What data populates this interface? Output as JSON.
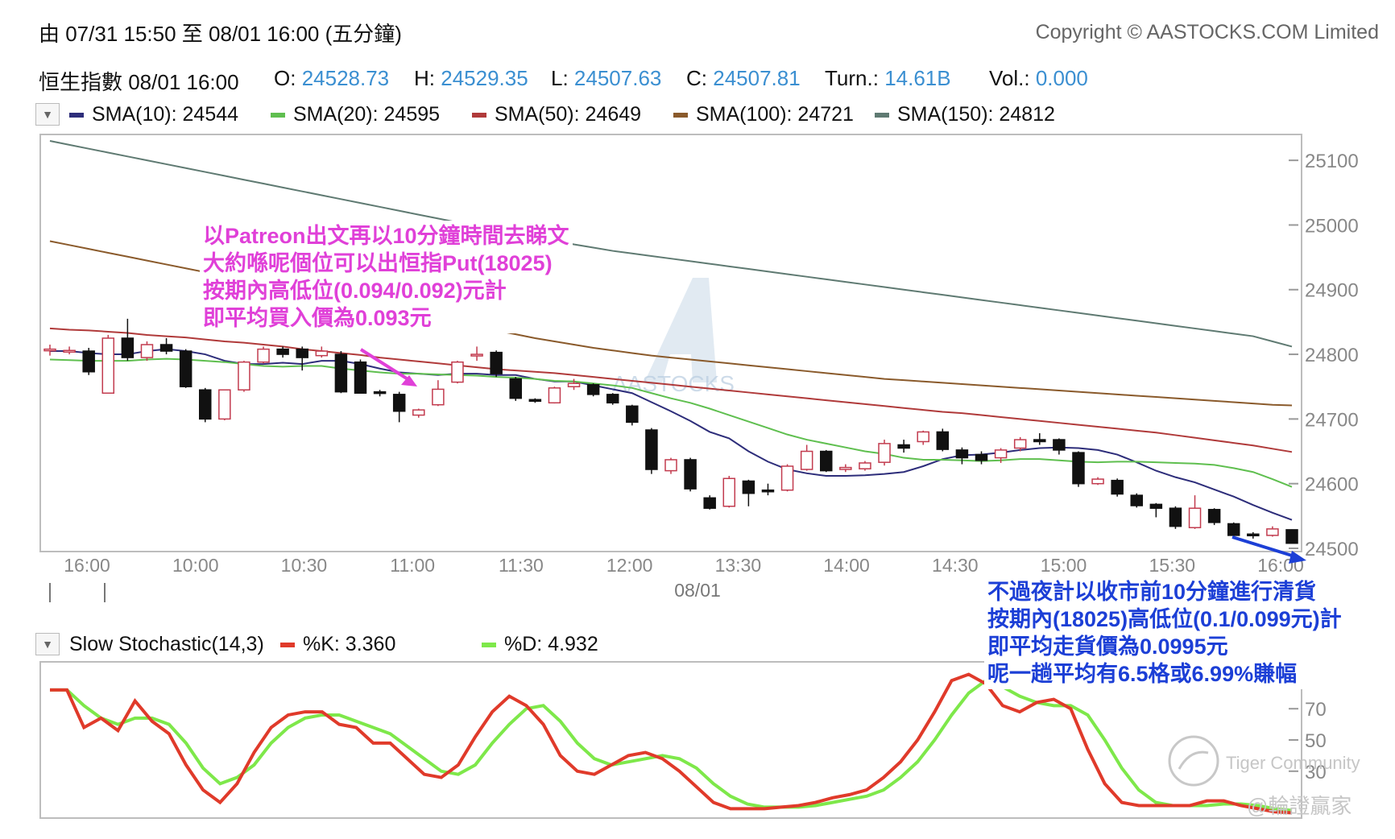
{
  "header": {
    "range": "由  07/31 15:50 至  08/01 16:00 (五分鐘)",
    "copyright": "Copyright © AASTOCKS.COM Limited"
  },
  "quote": {
    "name_time": "恒生指數 08/01 16:00",
    "o_label": "O:",
    "o_value": "24528.73",
    "h_label": "H:",
    "h_value": "24529.35",
    "l_label": "L:",
    "l_value": "24507.63",
    "c_label": "C:",
    "c_value": "24507.81",
    "turn_label": "Turn.:",
    "turn_value": "14.61B",
    "vol_label": "Vol.:",
    "vol_value": "0.000"
  },
  "legend": [
    {
      "label": "SMA(10): 24544",
      "color": "#2d2d7a"
    },
    {
      "label": "SMA(20): 24595",
      "color": "#5fbf4f"
    },
    {
      "label": "SMA(50): 24649",
      "color": "#b03a3a"
    },
    {
      "label": "SMA(100): 24721",
      "color": "#8a5a2b"
    },
    {
      "label": "SMA(150): 24812",
      "color": "#5f7a72"
    }
  ],
  "stoch_legend": {
    "title": "Slow Stochastic(14,3)",
    "k_label": "%K: 3.360",
    "k_color": "#e03a2a",
    "d_label": "%D: 4.932",
    "d_color": "#7ee84a"
  },
  "annotations": {
    "top_left": [
      "以Patreon出文再以10分鐘時間去睇文",
      "大約喺呢個位可以出恒指Put(18025)",
      "按期內高低位(0.094/0.092)元計",
      "即平均買入價為0.093元"
    ],
    "bottom_right": [
      "不過夜計以收市前10分鐘進行清貨",
      "按期內(18025)高低位(0.1/0.099元)計",
      "即平均走貨價為0.0995元",
      "呢一趟平均有6.5格或6.99%賺幅"
    ],
    "watermark": "AASTOCKS",
    "tiger": "Tiger Community",
    "author": "@輪證贏家"
  },
  "chart_data": [
    {
      "type": "candlestick",
      "title": "",
      "x_tick_labels": [
        "16:00",
        "10:00",
        "10:30",
        "11:00",
        "11:30",
        "12:00",
        "13:30",
        "14:00",
        "14:30",
        "15:00",
        "15:30",
        "16:00"
      ],
      "date_label": "08/01",
      "y_ticks": [
        25100,
        25000,
        24900,
        24800,
        24700,
        24600,
        24500
      ],
      "ylim": [
        24495,
        25140
      ],
      "candles": [
        {
          "o": 24808,
          "h": 24815,
          "l": 24798,
          "c": 24808
        },
        {
          "o": 24806,
          "h": 24812,
          "l": 24800,
          "c": 24806
        },
        {
          "o": 24805,
          "h": 24810,
          "l": 24768,
          "c": 24773
        },
        {
          "o": 24740,
          "h": 24830,
          "l": 24740,
          "c": 24825
        },
        {
          "o": 24825,
          "h": 24855,
          "l": 24790,
          "c": 24795
        },
        {
          "o": 24795,
          "h": 24820,
          "l": 24790,
          "c": 24815
        },
        {
          "o": 24815,
          "h": 24825,
          "l": 24800,
          "c": 24805
        },
        {
          "o": 24805,
          "h": 24808,
          "l": 24748,
          "c": 24750
        },
        {
          "o": 24745,
          "h": 24748,
          "l": 24695,
          "c": 24700
        },
        {
          "o": 24700,
          "h": 24745,
          "l": 24698,
          "c": 24745
        },
        {
          "o": 24745,
          "h": 24790,
          "l": 24742,
          "c": 24788
        },
        {
          "o": 24788,
          "h": 24812,
          "l": 24786,
          "c": 24808
        },
        {
          "o": 24808,
          "h": 24812,
          "l": 24795,
          "c": 24800
        },
        {
          "o": 24808,
          "h": 24812,
          "l": 24775,
          "c": 24795
        },
        {
          "o": 24798,
          "h": 24812,
          "l": 24795,
          "c": 24805
        },
        {
          "o": 24800,
          "h": 24805,
          "l": 24740,
          "c": 24742
        },
        {
          "o": 24788,
          "h": 24792,
          "l": 24740,
          "c": 24740
        },
        {
          "o": 24742,
          "h": 24745,
          "l": 24735,
          "c": 24740
        },
        {
          "o": 24738,
          "h": 24742,
          "l": 24695,
          "c": 24712
        },
        {
          "o": 24706,
          "h": 24716,
          "l": 24702,
          "c": 24714
        },
        {
          "o": 24722,
          "h": 24760,
          "l": 24720,
          "c": 24746
        },
        {
          "o": 24757,
          "h": 24790,
          "l": 24755,
          "c": 24788
        },
        {
          "o": 24798,
          "h": 24812,
          "l": 24790,
          "c": 24800
        },
        {
          "o": 24803,
          "h": 24806,
          "l": 24765,
          "c": 24770
        },
        {
          "o": 24762,
          "h": 24765,
          "l": 24728,
          "c": 24732
        },
        {
          "o": 24730,
          "h": 24732,
          "l": 24725,
          "c": 24729
        },
        {
          "o": 24725,
          "h": 24750,
          "l": 24724,
          "c": 24748
        },
        {
          "o": 24750,
          "h": 24762,
          "l": 24745,
          "c": 24755
        },
        {
          "o": 24753,
          "h": 24755,
          "l": 24735,
          "c": 24738
        },
        {
          "o": 24738,
          "h": 24740,
          "l": 24722,
          "c": 24725
        },
        {
          "o": 24720,
          "h": 24722,
          "l": 24690,
          "c": 24695
        },
        {
          "o": 24683,
          "h": 24686,
          "l": 24615,
          "c": 24622
        },
        {
          "o": 24620,
          "h": 24640,
          "l": 24615,
          "c": 24637
        },
        {
          "o": 24637,
          "h": 24640,
          "l": 24588,
          "c": 24592
        },
        {
          "o": 24578,
          "h": 24582,
          "l": 24560,
          "c": 24562
        },
        {
          "o": 24565,
          "h": 24612,
          "l": 24563,
          "c": 24608
        },
        {
          "o": 24604,
          "h": 24606,
          "l": 24565,
          "c": 24585
        },
        {
          "o": 24590,
          "h": 24600,
          "l": 24582,
          "c": 24588
        },
        {
          "o": 24590,
          "h": 24630,
          "l": 24588,
          "c": 24627
        },
        {
          "o": 24622,
          "h": 24660,
          "l": 24620,
          "c": 24650
        },
        {
          "o": 24650,
          "h": 24652,
          "l": 24618,
          "c": 24620
        },
        {
          "o": 24622,
          "h": 24630,
          "l": 24618,
          "c": 24625
        },
        {
          "o": 24623,
          "h": 24635,
          "l": 24620,
          "c": 24632
        },
        {
          "o": 24633,
          "h": 24668,
          "l": 24628,
          "c": 24662
        },
        {
          "o": 24660,
          "h": 24668,
          "l": 24648,
          "c": 24655
        },
        {
          "o": 24665,
          "h": 24682,
          "l": 24660,
          "c": 24680
        },
        {
          "o": 24680,
          "h": 24685,
          "l": 24650,
          "c": 24653
        },
        {
          "o": 24652,
          "h": 24656,
          "l": 24630,
          "c": 24640
        },
        {
          "o": 24645,
          "h": 24650,
          "l": 24630,
          "c": 24636
        },
        {
          "o": 24640,
          "h": 24655,
          "l": 24632,
          "c": 24652
        },
        {
          "o": 24655,
          "h": 24672,
          "l": 24650,
          "c": 24668
        },
        {
          "o": 24668,
          "h": 24678,
          "l": 24660,
          "c": 24665
        },
        {
          "o": 24668,
          "h": 24670,
          "l": 24645,
          "c": 24652
        },
        {
          "o": 24648,
          "h": 24650,
          "l": 24595,
          "c": 24600
        },
        {
          "o": 24600,
          "h": 24610,
          "l": 24598,
          "c": 24607
        },
        {
          "o": 24605,
          "h": 24608,
          "l": 24580,
          "c": 24584
        },
        {
          "o": 24582,
          "h": 24585,
          "l": 24563,
          "c": 24566
        },
        {
          "o": 24568,
          "h": 24570,
          "l": 24548,
          "c": 24562
        },
        {
          "o": 24562,
          "h": 24565,
          "l": 24530,
          "c": 24534
        },
        {
          "o": 24532,
          "h": 24582,
          "l": 24530,
          "c": 24562
        },
        {
          "o": 24560,
          "h": 24562,
          "l": 24536,
          "c": 24540
        },
        {
          "o": 24538,
          "h": 24540,
          "l": 24515,
          "c": 24520
        },
        {
          "o": 24522,
          "h": 24525,
          "l": 24515,
          "c": 24520
        },
        {
          "o": 24520,
          "h": 24534,
          "l": 24518,
          "c": 24530
        },
        {
          "o": 24528.73,
          "h": 24529.35,
          "l": 24507.63,
          "c": 24507.81
        }
      ],
      "sma": [
        {
          "name": "SMA(10)",
          "color": "#2d2d7a",
          "values": [
            24805,
            24805,
            24802,
            24800,
            24800,
            24805,
            24808,
            24805,
            24800,
            24790,
            24785,
            24785,
            24787,
            24785,
            24790,
            24790,
            24785,
            24778,
            24772,
            24770,
            24768,
            24770,
            24770,
            24768,
            24768,
            24762,
            24758,
            24758,
            24752,
            24746,
            24740,
            24726,
            24712,
            24697,
            24680,
            24670,
            24650,
            24634,
            24622,
            24616,
            24612,
            24612,
            24613,
            24615,
            24618,
            24627,
            24638,
            24644,
            24645,
            24648,
            24652,
            24655,
            24656,
            24655,
            24652,
            24645,
            24633,
            24620,
            24610,
            24602,
            24591,
            24580,
            24567,
            24555,
            24544
          ]
        },
        {
          "name": "SMA(20)",
          "color": "#5fbf4f",
          "values": [
            24792,
            24791,
            24790,
            24790,
            24790,
            24792,
            24793,
            24792,
            24790,
            24788,
            24785,
            24782,
            24781,
            24782,
            24782,
            24778,
            24775,
            24772,
            24770,
            24770,
            24769,
            24768,
            24767,
            24765,
            24764,
            24762,
            24759,
            24758,
            24755,
            24752,
            24748,
            24740,
            24732,
            24725,
            24716,
            24706,
            24696,
            24686,
            24676,
            24668,
            24662,
            24656,
            24650,
            24646,
            24640,
            24637,
            24637,
            24636,
            24635,
            24636,
            24638,
            24638,
            24636,
            24634,
            24633,
            24634,
            24634,
            24633,
            24632,
            24631,
            24629,
            24624,
            24618,
            24607,
            24595
          ]
        },
        {
          "name": "SMA(50)",
          "color": "#b03a3a",
          "values": [
            24840,
            24838,
            24837,
            24835,
            24833,
            24830,
            24828,
            24826,
            24823,
            24820,
            24818,
            24815,
            24812,
            24808,
            24805,
            24802,
            24799,
            24795,
            24792,
            24789,
            24786,
            24783,
            24780,
            24777,
            24775,
            24773,
            24771,
            24768,
            24765,
            24762,
            24759,
            24756,
            24753,
            24750,
            24747,
            24744,
            24741,
            24738,
            24735,
            24732,
            24729,
            24726,
            24723,
            24720,
            24717,
            24714,
            24711,
            24709,
            24706,
            24703,
            24700,
            24697,
            24694,
            24691,
            24688,
            24685,
            24682,
            24679,
            24675,
            24671,
            24667,
            24663,
            24659,
            24654,
            24649
          ]
        },
        {
          "name": "SMA(100)",
          "color": "#8a5a2b",
          "values": [
            24975,
            24969,
            24963,
            24957,
            24951,
            24945,
            24939,
            24933,
            24927,
            24921,
            24915,
            24909,
            24903,
            24897,
            24891,
            24885,
            24879,
            24873,
            24867,
            24861,
            24855,
            24849,
            24843,
            24837,
            24831,
            24825,
            24820,
            24815,
            24810,
            24806,
            24802,
            24798,
            24795,
            24792,
            24789,
            24786,
            24783,
            24780,
            24777,
            24774,
            24771,
            24768,
            24765,
            24762,
            24760,
            24758,
            24756,
            24754,
            24752,
            24750,
            24748,
            24746,
            24744,
            24742,
            24740,
            24738,
            24736,
            24734,
            24732,
            24730,
            24728,
            24726,
            24724,
            24722,
            24721
          ]
        },
        {
          "name": "SMA(150)",
          "color": "#5f7a72",
          "values": [
            25130,
            25124,
            25118,
            25112,
            25106,
            25100,
            25094,
            25088,
            25082,
            25076,
            25070,
            25064,
            25058,
            25052,
            25046,
            25040,
            25034,
            25028,
            25022,
            25016,
            25010,
            25004,
            24998,
            24992,
            24986,
            24980,
            24975,
            24970,
            24965,
            24960,
            24956,
            24952,
            24948,
            24944,
            24940,
            24936,
            24932,
            24928,
            24924,
            24920,
            24916,
            24912,
            24908,
            24904,
            24900,
            24896,
            24892,
            24888,
            24884,
            24880,
            24876,
            24872,
            24868,
            24864,
            24860,
            24856,
            24852,
            24848,
            24844,
            24840,
            24836,
            24832,
            24828,
            24820,
            24812
          ]
        }
      ]
    },
    {
      "type": "line",
      "title": "Slow Stochastic(14,3)",
      "y_ticks": [
        70,
        50,
        30
      ],
      "ylim": [
        0,
        100
      ],
      "series": [
        {
          "name": "%K",
          "color": "#e03a2a",
          "values": [
            82,
            82,
            58,
            64,
            56,
            75,
            62,
            54,
            34,
            18,
            10,
            22,
            42,
            58,
            66,
            68,
            68,
            60,
            58,
            48,
            48,
            38,
            28,
            26,
            34,
            52,
            68,
            78,
            72,
            60,
            40,
            30,
            28,
            34,
            40,
            42,
            38,
            30,
            20,
            10,
            6,
            6,
            6,
            7,
            8,
            10,
            13,
            15,
            18,
            26,
            36,
            50,
            68,
            88,
            92,
            86,
            72,
            68,
            74,
            76,
            70,
            44,
            22,
            10,
            8,
            8,
            8,
            8,
            11,
            11,
            8,
            6,
            4,
            3.36
          ]
        },
        {
          "name": "%D",
          "color": "#7ee84a",
          "values": [
            82,
            82,
            72,
            64,
            60,
            64,
            64,
            60,
            48,
            32,
            22,
            26,
            34,
            48,
            58,
            64,
            66,
            66,
            62,
            58,
            54,
            46,
            38,
            30,
            28,
            34,
            48,
            60,
            70,
            72,
            62,
            48,
            38,
            34,
            36,
            38,
            40,
            38,
            32,
            22,
            14,
            9,
            7,
            7,
            7,
            8,
            10,
            12,
            14,
            18,
            26,
            36,
            50,
            66,
            80,
            88,
            84,
            78,
            74,
            72,
            72,
            66,
            50,
            32,
            18,
            10,
            8,
            8,
            8,
            9,
            9,
            8,
            6,
            4.93
          ]
        }
      ]
    }
  ]
}
